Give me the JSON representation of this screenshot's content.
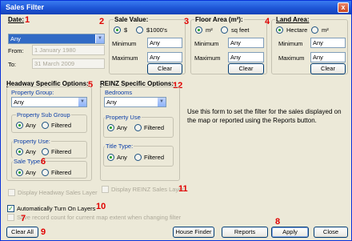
{
  "window": {
    "title": "Sales Filter",
    "close_glyph": "x"
  },
  "date": {
    "title": "Date:",
    "option": "Any",
    "from_label": "From:",
    "from_value": "1 January 1980",
    "to_label": "To:",
    "to_value": "31 March 2009"
  },
  "sale_value": {
    "title": "Sale Value:",
    "radio_dollar": "$",
    "radio_thousands": "$1000's",
    "min_label": "Minimum",
    "min_value": "Any",
    "max_label": "Maximum",
    "max_value": "Any",
    "clear": "Clear"
  },
  "floor_area": {
    "title": "Floor Area (m²):",
    "radio_m2": "m²",
    "radio_sqft": "sq feet",
    "min_label": "Minimum",
    "min_value": "Any",
    "max_label": "Maximum",
    "max_value": "Any",
    "clear": "Clear"
  },
  "land_area": {
    "title": "Land Area:",
    "radio_hectare": "Hectare",
    "radio_m2": "m²",
    "min_label": "Minimum",
    "min_value": "Any",
    "max_label": "Maximum",
    "max_value": "Any",
    "clear": "Clear"
  },
  "headway": {
    "title": "Headway Specific Options:",
    "property_group_label": "Property Group:",
    "property_group_value": "Any",
    "property_sub_group_label": "Property Sub Group",
    "property_use_label": "Property Use:",
    "sale_type_label": "Sale Type:",
    "radio_any": "Any",
    "radio_filtered": "Filtered",
    "display_layer": "Display Headway Sales Layer"
  },
  "reinz": {
    "title": "REINZ Specific Options:",
    "bedrooms_label": "Bedrooms",
    "bedrooms_value": "Any",
    "property_use_label": "Property Use",
    "title_type_label": "Title Type:",
    "radio_any": "Any",
    "radio_filtered": "Filtered",
    "display_layer": "Display REINZ Sales Layer"
  },
  "info_text": "Use this form to set the filter for the sales displayed on the map or reported using the Reports button.",
  "options": {
    "auto_layers": "Automatically Turn On Layers",
    "map_extent": "Save record count for current map extent when changing filter"
  },
  "buttons": {
    "clear_all": "Clear All",
    "house_finder": "House Finder",
    "reports": "Reports",
    "apply": "Apply",
    "close": "Close"
  },
  "annotations": [
    "1",
    "2",
    "3",
    "4",
    "5",
    "6",
    "7",
    "8",
    "9",
    "10",
    "11",
    "12"
  ]
}
